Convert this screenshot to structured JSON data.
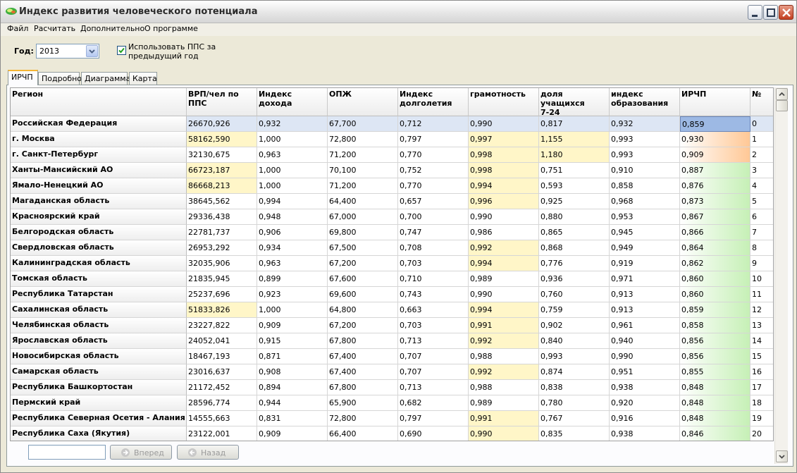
{
  "window": {
    "title": "Индекс развития человеческого потенциала"
  },
  "menu": [
    "Файл",
    "Расчитать",
    "Дополнительно",
    "О программе"
  ],
  "controls": {
    "year_label": "Год:",
    "year_value": "2013",
    "checkbox_checked": true,
    "checkbox_label": "Использовать ППС за предыдущий год"
  },
  "tabs": [
    "ИРЧП",
    "Подробно",
    "Диаграмма",
    "Карта"
  ],
  "active_tab": "ИРЧП",
  "table": {
    "columns": [
      "Регион",
      "ВРП/чел по ППС",
      "Индекс дохода",
      "ОПЖ",
      "Индекс\nдолголетия",
      "грамотность",
      "доля учащихся\n7-24",
      "индекс\nобразования",
      "ИРЧП",
      "№"
    ],
    "rows": [
      [
        "Российская Федерация",
        "26670,926",
        "0,932",
        "67,700",
        "0,712",
        "0,990",
        "0,817",
        "0,932",
        "0,859",
        "0"
      ],
      [
        "г. Москва",
        "58162,590",
        "1,000",
        "72,800",
        "0,797",
        "0,997",
        "1,155",
        "0,993",
        "0,930",
        "1"
      ],
      [
        "г. Санкт-Петербург",
        "32130,675",
        "0,963",
        "71,200",
        "0,770",
        "0,998",
        "1,180",
        "0,993",
        "0,909",
        "2"
      ],
      [
        "Ханты-Мансийский АО",
        "66723,187",
        "1,000",
        "70,100",
        "0,752",
        "0,998",
        "0,751",
        "0,910",
        "0,887",
        "3"
      ],
      [
        "Ямало-Ненецкий АО",
        "86668,213",
        "1,000",
        "71,200",
        "0,770",
        "0,994",
        "0,593",
        "0,858",
        "0,876",
        "4"
      ],
      [
        "Магаданская область",
        "38645,562",
        "0,994",
        "64,400",
        "0,657",
        "0,996",
        "0,925",
        "0,968",
        "0,873",
        "5"
      ],
      [
        "Красноярский край",
        "29336,438",
        "0,948",
        "67,000",
        "0,700",
        "0,990",
        "0,880",
        "0,953",
        "0,867",
        "6"
      ],
      [
        "Белгородская область",
        "22781,737",
        "0,906",
        "69,800",
        "0,747",
        "0,986",
        "0,865",
        "0,945",
        "0,866",
        "7"
      ],
      [
        "Свердловская область",
        "26953,292",
        "0,934",
        "67,500",
        "0,708",
        "0,992",
        "0,868",
        "0,949",
        "0,864",
        "8"
      ],
      [
        "Калининградская область",
        "32035,906",
        "0,963",
        "67,200",
        "0,703",
        "0,994",
        "0,776",
        "0,919",
        "0,862",
        "9"
      ],
      [
        "Томская область",
        "21835,945",
        "0,899",
        "67,600",
        "0,710",
        "0,989",
        "0,936",
        "0,971",
        "0,860",
        "10"
      ],
      [
        "Республика Татарстан",
        "25237,696",
        "0,923",
        "69,600",
        "0,743",
        "0,990",
        "0,760",
        "0,913",
        "0,860",
        "11"
      ],
      [
        "Сахалинская область",
        "51833,826",
        "1,000",
        "64,800",
        "0,663",
        "0,994",
        "0,759",
        "0,913",
        "0,859",
        "12"
      ],
      [
        "Челябинская область",
        "23227,822",
        "0,909",
        "67,200",
        "0,703",
        "0,991",
        "0,902",
        "0,961",
        "0,858",
        "13"
      ],
      [
        "Ярославская область",
        "24052,041",
        "0,915",
        "67,800",
        "0,713",
        "0,992",
        "0,840",
        "0,940",
        "0,856",
        "14"
      ],
      [
        "Новосибирская область",
        "18467,193",
        "0,871",
        "67,400",
        "0,707",
        "0,988",
        "0,993",
        "0,990",
        "0,856",
        "15"
      ],
      [
        "Самарская область",
        "23016,637",
        "0,908",
        "67,400",
        "0,707",
        "0,992",
        "0,874",
        "0,951",
        "0,855",
        "16"
      ],
      [
        "Республика Башкортостан",
        "21172,452",
        "0,894",
        "67,800",
        "0,713",
        "0,988",
        "0,838",
        "0,938",
        "0,848",
        "17"
      ],
      [
        "Пермский край",
        "28596,774",
        "0,944",
        "65,900",
        "0,682",
        "0,989",
        "0,780",
        "0,920",
        "0,848",
        "18"
      ],
      [
        "Республика Северная Осетия - Алания",
        "14555,663",
        "0,831",
        "72,800",
        "0,797",
        "0,991",
        "0,767",
        "0,916",
        "0,848",
        "19"
      ],
      [
        "Республика Саха (Якутия)",
        "23122,001",
        "0,909",
        "66,400",
        "0,690",
        "0,990",
        "0,835",
        "0,938",
        "0,846",
        "20"
      ]
    ],
    "highlights": {
      "yellow": [
        [
          1,
          1
        ],
        [
          1,
          5
        ],
        [
          1,
          6
        ],
        [
          2,
          5
        ],
        [
          2,
          6
        ],
        [
          3,
          1
        ],
        [
          3,
          5
        ],
        [
          4,
          1
        ],
        [
          4,
          5
        ],
        [
          5,
          5
        ],
        [
          8,
          5
        ],
        [
          9,
          5
        ],
        [
          12,
          1
        ],
        [
          12,
          5
        ],
        [
          13,
          5
        ],
        [
          14,
          5
        ],
        [
          16,
          5
        ],
        [
          19,
          5
        ],
        [
          20,
          5
        ]
      ],
      "orange": [
        [
          1,
          8
        ],
        [
          2,
          8
        ]
      ],
      "selected": [
        [
          0,
          8
        ]
      ]
    }
  },
  "nav": {
    "input_value": "",
    "forward_label": "Вперед",
    "back_label": "Назад"
  },
  "colors": {
    "highlight_yellow": "#fff6c8",
    "highlight_green": "#c6f0b6",
    "highlight_orange": "#ffc896",
    "selection": "#a9c2e8"
  }
}
